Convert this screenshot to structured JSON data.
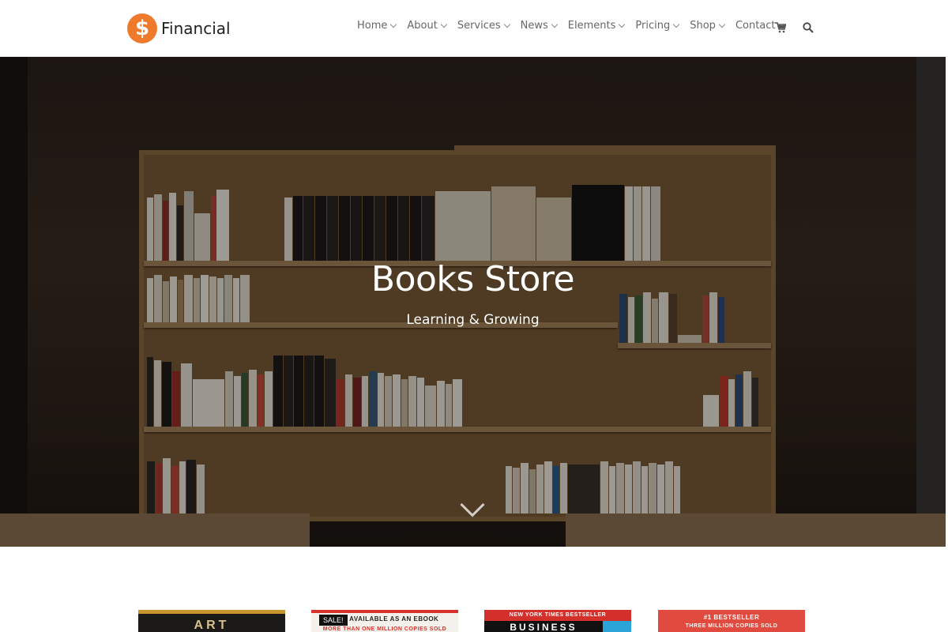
{
  "header": {
    "logo_symbol": "$",
    "logo_text": "Financial",
    "brand_color": "#ef7a2b",
    "nav": [
      {
        "label": "Home"
      },
      {
        "label": "About"
      },
      {
        "label": "Services"
      },
      {
        "label": "News"
      },
      {
        "label": "Elements"
      },
      {
        "label": "Pricing"
      },
      {
        "label": "Shop"
      },
      {
        "label": "Contact"
      }
    ],
    "icons": [
      "cart-icon",
      "search-icon"
    ]
  },
  "hero": {
    "title": "Books Store",
    "subtitle": "Learning & Growing",
    "scroll_icon": "chevron-down-icon"
  },
  "products": [
    {
      "cover_text": "ART"
    },
    {
      "badge": "SALE!",
      "cover_text": "NOW AVAILABLE AS AN EBOOK",
      "cover_subtext": "MORE THAN ONE MILLION COPIES SOLD"
    },
    {
      "cover_text": "NEW YORK TIMES BESTSELLER",
      "cover_subtext": "BUSINESS"
    },
    {
      "cover_text": "#1 BESTSELLER",
      "cover_subtext": "THREE MILLION COPIES SOLD"
    }
  ]
}
